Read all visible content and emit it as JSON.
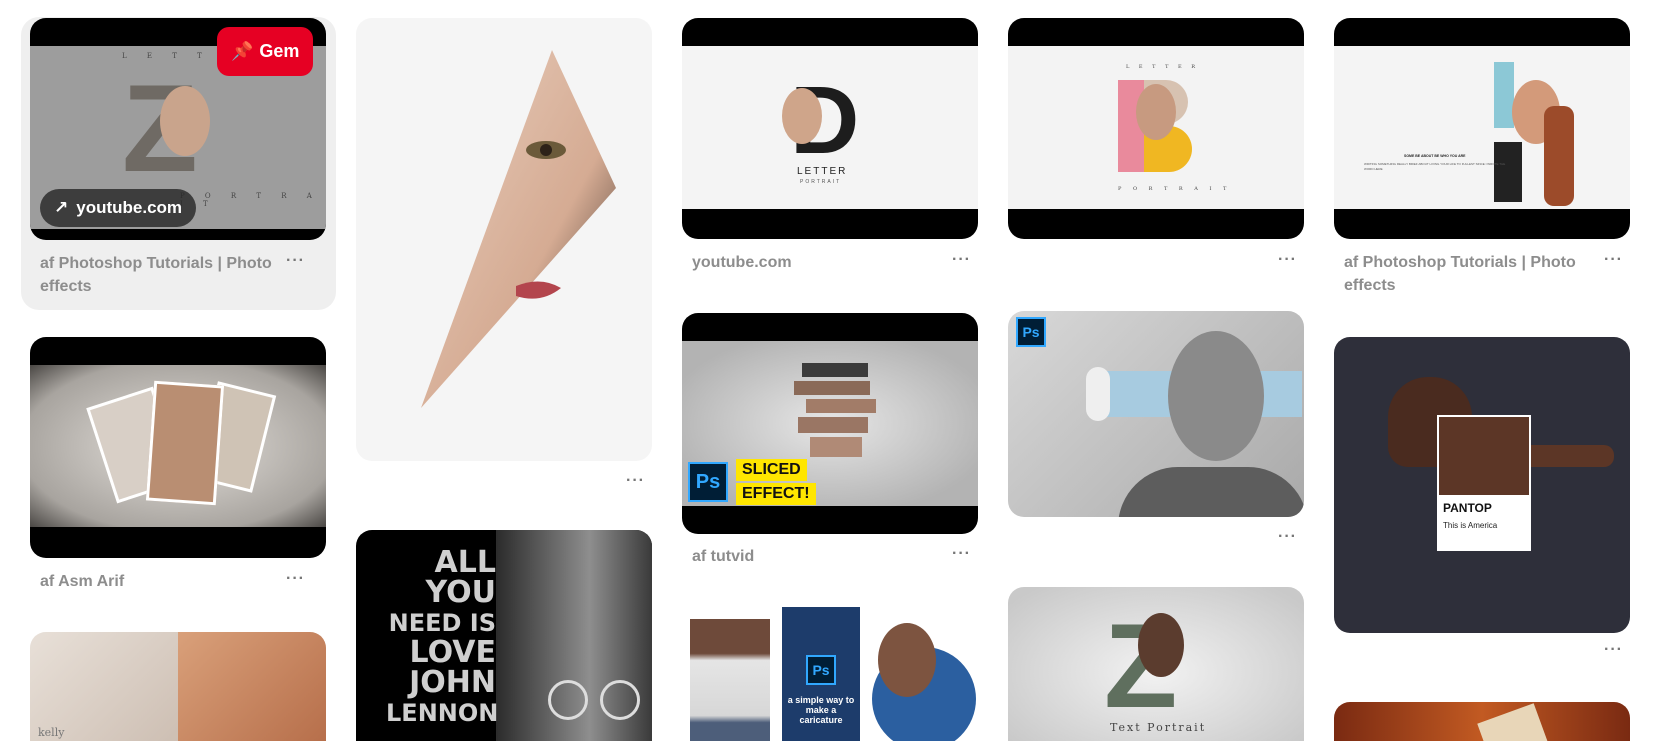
{
  "pins": {
    "col1": {
      "pin1": {
        "title": "af Photoshop Tutorials | Photo effects",
        "save_label": "Gem",
        "link_label": "youtube.com",
        "art_top": "L E T T E R",
        "art_letter": "Z",
        "art_bottom": "P O R T R A I T"
      },
      "pin2": {
        "title": "af Asm Arif"
      },
      "pin3": {
        "art_text": "kelly"
      }
    },
    "col2": {
      "pin1": {},
      "pin2": {
        "art_lines": [
          "ALL",
          "YOU",
          "NEED IS",
          "LOVE",
          "JOHN",
          "LENNON"
        ]
      }
    },
    "col3": {
      "pin1": {
        "title": "youtube.com",
        "art_letter": "D",
        "art_caption": "LETTER",
        "art_sub": "PORTRAIT"
      },
      "pin2": {
        "title": "af tutvid",
        "badge": "Ps",
        "tag1": "SLICED",
        "tag2": "EFFECT!"
      },
      "pin3": {
        "badge": "Ps",
        "art_caption": "a simple way to make a caricature"
      }
    },
    "col4": {
      "pin1": {
        "art_top": "L E T T E R",
        "art_letter": "B",
        "art_bottom": "P O R T R A I T"
      },
      "pin2": {
        "badge": "Ps"
      },
      "pin3": {
        "art_letter": "Z",
        "art_caption": "Text Portrait"
      }
    },
    "col5": {
      "pin1": {
        "title": "af Photoshop Tutorials | Photo effects",
        "art_letters": "B D",
        "art_heading": "SOME BE ABOUT BE WHO YOU ARE",
        "art_body": "WRITING SOMETHING REALLY BRIEF ABOUT LIVING YOUR LIFE TO FULLEST SINCE I WROTE THE WORD HERE"
      },
      "pin2": {
        "swatch_name": "PANTOP",
        "swatch_sub": "This is America"
      },
      "pin3": {}
    }
  },
  "more_label": "···",
  "colors": {
    "brand_red": "#e60023",
    "meta_text": "#8d8d8d",
    "hover_bg": "#efefef",
    "ps_blue": "#31a8ff"
  }
}
